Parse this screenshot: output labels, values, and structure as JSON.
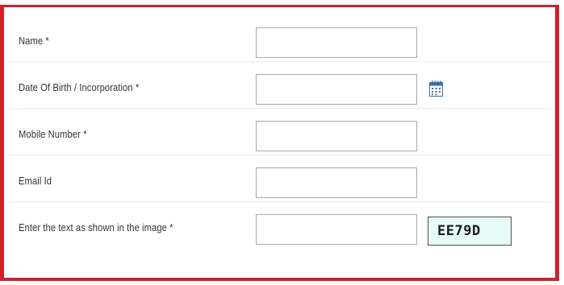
{
  "form": {
    "fields": [
      {
        "label": "Name *",
        "value": ""
      },
      {
        "label": "Date Of Birth / Incorporation *",
        "value": ""
      },
      {
        "label": "Mobile Number *",
        "value": ""
      },
      {
        "label": "Email Id",
        "value": ""
      },
      {
        "label": "Enter the text as shown in the image *",
        "value": ""
      }
    ],
    "calendar_icon": "calendar-icon",
    "captcha_text": "EE79D"
  },
  "colors": {
    "border_accent": "#d0202a",
    "captcha_background": "#e6fbf8"
  }
}
